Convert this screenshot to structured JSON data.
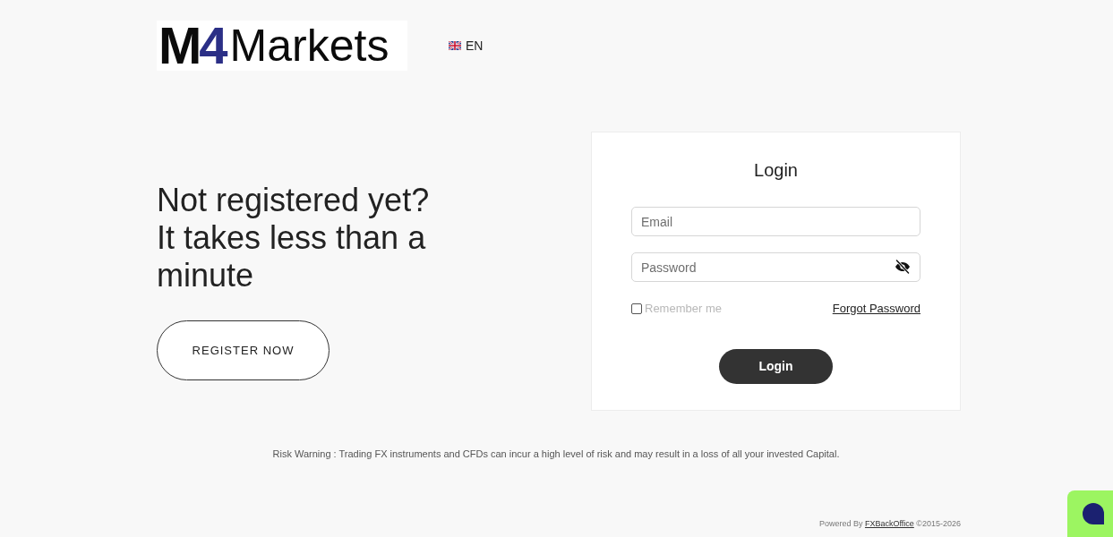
{
  "header": {
    "logo": {
      "letter": "M",
      "digit": "4",
      "name": "Markets"
    },
    "language": {
      "code": "EN"
    }
  },
  "promo": {
    "heading": "Not registered yet? It takes less than a minute",
    "button": "REGISTER NOW"
  },
  "login": {
    "title": "Login",
    "fields": [
      {
        "kind": "text",
        "placeholder": "Email"
      },
      {
        "kind": "password",
        "placeholder": "Password"
      }
    ],
    "remember": {
      "label": "Remember me",
      "checked": false
    },
    "forgot_link": "Forgot Password",
    "submit": "Login"
  },
  "risk_warning": "Risk Warning : Trading FX instruments and CFDs can incur a high level of risk and may result in a loss of all your invested Capital.",
  "footer": {
    "prefix": "Powered By",
    "link": "FXBackOffice",
    "suffix": "©2015-2026"
  }
}
